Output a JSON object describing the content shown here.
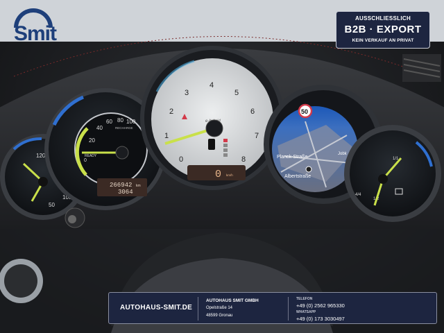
{
  "overlay": {
    "logo_text": "Smit",
    "badge": {
      "line1": "AUSSCHLIESSLICH",
      "line2": "B2B  ·  EXPORT",
      "line3": "KEIN VERKAUF AN PRIVAT"
    },
    "footer": {
      "website": "AUTOHAUS-SMIT.DE",
      "company": "AUTOHAUS SMIT GMBH",
      "street": "Opelstraße 14",
      "city": "48599 Gronau",
      "phone_label": "TELEFON",
      "phone": "+49 (0) 2562 965330",
      "whatsapp_label": "WHATSAPP",
      "whatsapp": "+49 (0) 173 3030497"
    }
  },
  "dashboard": {
    "center_gauge": {
      "ticks": [
        "0",
        "1",
        "2",
        "3",
        "4",
        "5",
        "6",
        "7",
        "8"
      ],
      "hybrid_label": "e-hybrid",
      "speed": "0",
      "speed_unit": "km/h"
    },
    "left_gauge": {
      "ticks": [
        "0",
        "20",
        "40",
        "60",
        "80",
        "100"
      ],
      "recharge_label": "RECHARGE",
      "ready_label": "READY",
      "odometer": "266942",
      "odometer_unit": "km",
      "trip": "3064"
    },
    "far_left_gauge": {
      "ticks": [
        "120",
        "50",
        "100"
      ]
    },
    "nav_screen": {
      "speed_limit": "50",
      "street_1": "Planck-Straße",
      "street_2": "Albertstraße",
      "street_3": "Jobk"
    },
    "far_right_gauge": {
      "ticks": [
        "1/1",
        "1/2",
        "4/4"
      ]
    }
  },
  "colors": {
    "needle": "#c9e04a",
    "brand_blue": "#1e3f7a",
    "overlay_navy": "#1d2540",
    "gauge_face": "#d8dadb",
    "nav_blue": "#2c5fa6"
  }
}
